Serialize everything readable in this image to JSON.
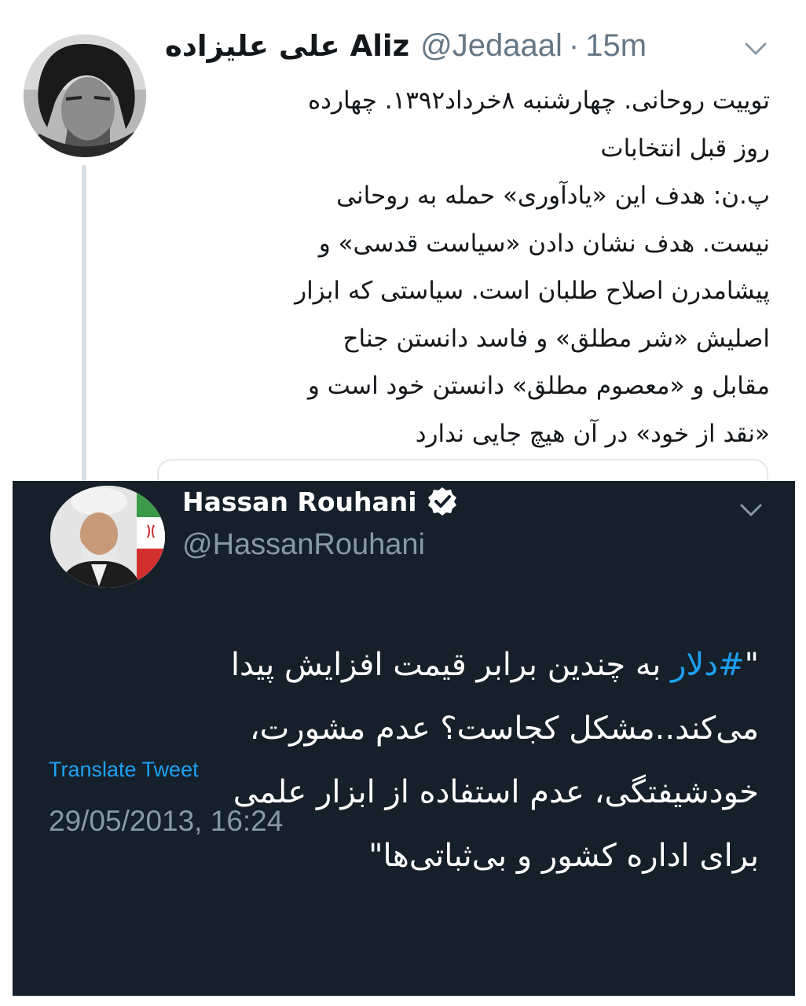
{
  "top_tweet": {
    "display_name": "علی علیزاده Aliz",
    "handle": "@Jedaaal",
    "separator": "·",
    "time": "15m",
    "avatar_icon": "user-avatar-photo",
    "menu_icon": "chevron-down-icon",
    "lines": [
      "توییت روحانی. چهارشنبه ۸خرداد۱۳۹۲. چهارده",
      "روز قبل انتخابات",
      "پ.ن: هدف این «یادآوری» حمله به روحانی",
      "نیست. هدف نشان دادن «سیاست قدسی» و",
      "پیشامدرن اصلاح طلبان است. سیاستی که ابزار",
      "اصلیش «شر مطلق» و فاسد دانستن جناح",
      "مقابل و «معصوم مطلق» دانستن خود است و",
      "«نقد از خود» در آن هیچ جایی ندارد"
    ]
  },
  "quoted_tweet": {
    "display_name": "Hassan Rouhani",
    "handle": "@HassanRouhani",
    "verified_icon": "verified-badge-icon",
    "menu_icon": "chevron-down-icon",
    "avatar_icon": "user-avatar-photo",
    "quote_open": "\"",
    "hashtag": "#دلار",
    "line1_rest": " به چندین برابر قیمت افزایش پیدا",
    "lines": [
      "می‌کند..مشکل کجاست؟ عدم مشورت،",
      "خودشیفتگی، عدم استفاده از ابزار علمی",
      "برای اداره کشور و بی‌ثباتی‌ها\""
    ],
    "translate_label": "Translate Tweet",
    "timestamp": "29/05/2013, 16:24",
    "colors": {
      "background": "#15202b",
      "link": "#1da1f2",
      "muted": "#8899a6"
    }
  }
}
